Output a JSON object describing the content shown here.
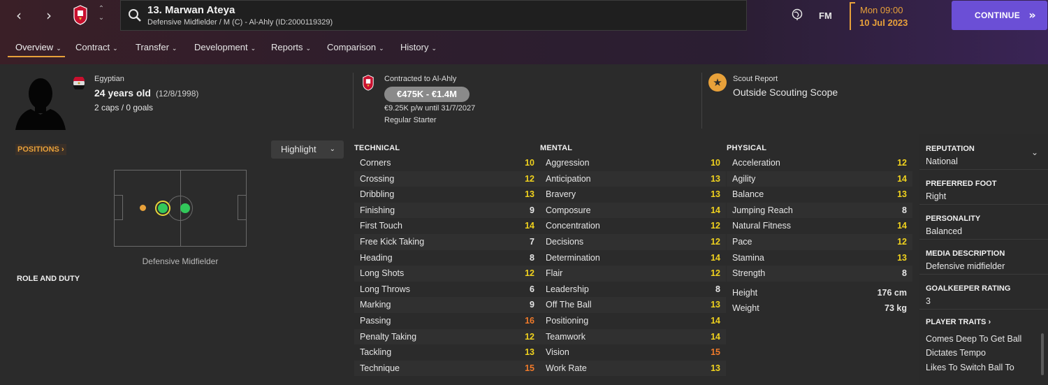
{
  "header": {
    "player_name": "13. Marwan Ateya",
    "player_sub": "Defensive Midfielder / M (C) - Al-Ahly (ID:2000119329)",
    "fm_label": "FM",
    "date_day": "Mon 09:00",
    "date_full": "10 Jul 2023",
    "continue_label": "CONTINUE",
    "accent_color": "#e8a13a",
    "continue_color": "#6b4fd6"
  },
  "tabs": [
    {
      "label": "Overview"
    },
    {
      "label": "Contract"
    },
    {
      "label": "Transfer"
    },
    {
      "label": "Development"
    },
    {
      "label": "Reports"
    },
    {
      "label": "Comparison"
    },
    {
      "label": "History"
    }
  ],
  "info": {
    "nationality": "Egyptian",
    "age": "24 years old",
    "dob": "(12/8/1998)",
    "caps": "2 caps / 0 goals",
    "contract_label": "Contracted to Al-Ahly",
    "value_range": "€475K - €1.4M",
    "wage": "€9.25K p/w until 31/7/2027",
    "squad_status": "Regular Starter",
    "scout_label": "Scout Report",
    "scout_value": "Outside Scouting Scope"
  },
  "positions": {
    "button_label": "POSITIONS",
    "position_name": "Defensive Midfielder",
    "role_title": "ROLE AND DUTY",
    "highlight_label": "Highlight"
  },
  "attributes": {
    "technical": {
      "title": "TECHNICAL",
      "items": [
        {
          "name": "Corners",
          "value": "10"
        },
        {
          "name": "Crossing",
          "value": "12"
        },
        {
          "name": "Dribbling",
          "value": "13"
        },
        {
          "name": "Finishing",
          "value": "9"
        },
        {
          "name": "First Touch",
          "value": "14"
        },
        {
          "name": "Free Kick Taking",
          "value": "7"
        },
        {
          "name": "Heading",
          "value": "8"
        },
        {
          "name": "Long Shots",
          "value": "12"
        },
        {
          "name": "Long Throws",
          "value": "6"
        },
        {
          "name": "Marking",
          "value": "9"
        },
        {
          "name": "Passing",
          "value": "16"
        },
        {
          "name": "Penalty Taking",
          "value": "12"
        },
        {
          "name": "Tackling",
          "value": "13"
        },
        {
          "name": "Technique",
          "value": "15"
        }
      ]
    },
    "mental": {
      "title": "MENTAL",
      "items": [
        {
          "name": "Aggression",
          "value": "10"
        },
        {
          "name": "Anticipation",
          "value": "13"
        },
        {
          "name": "Bravery",
          "value": "13"
        },
        {
          "name": "Composure",
          "value": "14"
        },
        {
          "name": "Concentration",
          "value": "12"
        },
        {
          "name": "Decisions",
          "value": "12"
        },
        {
          "name": "Determination",
          "value": "14"
        },
        {
          "name": "Flair",
          "value": "12"
        },
        {
          "name": "Leadership",
          "value": "8"
        },
        {
          "name": "Off The Ball",
          "value": "13"
        },
        {
          "name": "Positioning",
          "value": "14"
        },
        {
          "name": "Teamwork",
          "value": "14"
        },
        {
          "name": "Vision",
          "value": "15"
        },
        {
          "name": "Work Rate",
          "value": "13"
        }
      ]
    },
    "physical": {
      "title": "PHYSICAL",
      "items": [
        {
          "name": "Acceleration",
          "value": "12"
        },
        {
          "name": "Agility",
          "value": "14"
        },
        {
          "name": "Balance",
          "value": "13"
        },
        {
          "name": "Jumping Reach",
          "value": "8"
        },
        {
          "name": "Natural Fitness",
          "value": "14"
        },
        {
          "name": "Pace",
          "value": "12"
        },
        {
          "name": "Stamina",
          "value": "13"
        },
        {
          "name": "Strength",
          "value": "8"
        }
      ],
      "height_label": "Height",
      "height_value": "176 cm",
      "weight_label": "Weight",
      "weight_value": "73 kg"
    }
  },
  "side": {
    "reputation_label": "REPUTATION",
    "reputation_value": "National",
    "foot_label": "PREFERRED FOOT",
    "foot_value": "Right",
    "personality_label": "PERSONALITY",
    "personality_value": "Balanced",
    "media_label": "MEDIA DESCRIPTION",
    "media_value": "Defensive midfielder",
    "gk_label": "GOALKEEPER RATING",
    "gk_value": "3",
    "traits_label": "PLAYER TRAITS",
    "traits": [
      "Comes Deep To Get Ball",
      "Dictates Tempo",
      "Likes To Switch Ball To"
    ]
  }
}
